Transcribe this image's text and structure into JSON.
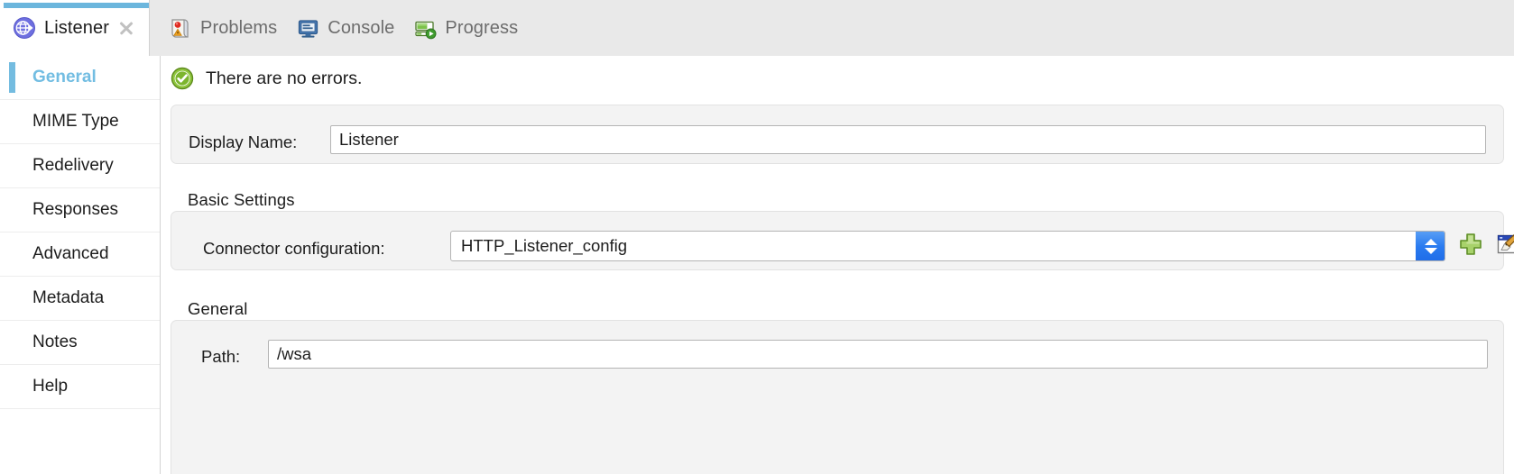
{
  "window": {
    "tabs": [
      {
        "label": "Listener",
        "icon": "globe-arrow-icon",
        "active": true,
        "closable": true
      },
      {
        "label": "Problems",
        "icon": "problems-icon",
        "active": false
      },
      {
        "label": "Console",
        "icon": "console-monitor-icon",
        "active": false
      },
      {
        "label": "Progress",
        "icon": "progress-bar-icon",
        "active": false
      }
    ]
  },
  "sidebar": {
    "items": [
      {
        "label": "General",
        "selected": true
      },
      {
        "label": "MIME Type",
        "selected": false
      },
      {
        "label": "Redelivery",
        "selected": false
      },
      {
        "label": "Responses",
        "selected": false
      },
      {
        "label": "Advanced",
        "selected": false
      },
      {
        "label": "Metadata",
        "selected": false
      },
      {
        "label": "Notes",
        "selected": false
      },
      {
        "label": "Help",
        "selected": false
      }
    ]
  },
  "status": {
    "icon": "success-check-icon",
    "message": "There are no errors."
  },
  "form": {
    "display_name": {
      "label": "Display Name:",
      "value": "Listener"
    },
    "basic_settings": {
      "title": "Basic Settings",
      "connector_configuration": {
        "label": "Connector configuration:",
        "value": "HTTP_Listener_config",
        "add_icon": "plus-icon",
        "edit_icon": "edit-pencil-icon"
      }
    },
    "general": {
      "title": "General",
      "path": {
        "label": "Path:",
        "value": "/wsa"
      }
    }
  },
  "colors": {
    "accent_blue": "#74bce0",
    "selected_text": "#72bde2",
    "combo_button": "#2a7bf0",
    "success_green": "#6cb020",
    "tabbar_bg": "#e9e9e9",
    "panel_bg": "#f3f3f3"
  }
}
